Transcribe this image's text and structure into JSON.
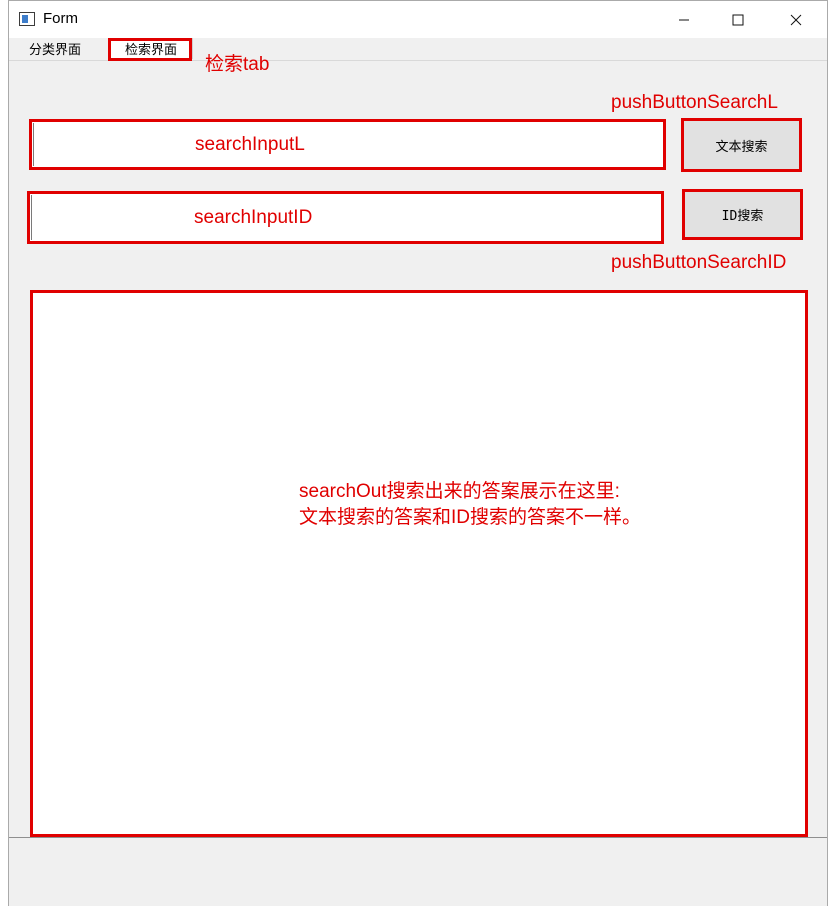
{
  "window": {
    "title": "Form",
    "controls": {
      "minimize": "minimize",
      "maximize": "maximize",
      "close": "close"
    }
  },
  "tabs": [
    {
      "label": "分类界面",
      "active": false
    },
    {
      "label": "检索界面",
      "active": true
    }
  ],
  "annotations": {
    "tab": "检索tab",
    "button_l": "pushButtonSearchL",
    "button_id": "pushButtonSearchID"
  },
  "search": {
    "input_l_label": "searchInputL",
    "input_id_label": "searchInputID",
    "button_l_label": "文本搜索",
    "button_id_label": "ID搜索"
  },
  "output": {
    "line1": "searchOut搜索出来的答案展示在这里:",
    "line2": "文本搜索的答案和ID搜索的答案不一样。"
  },
  "colors": {
    "annotation": "#e00000",
    "window_bg": "#f0f0f0"
  }
}
